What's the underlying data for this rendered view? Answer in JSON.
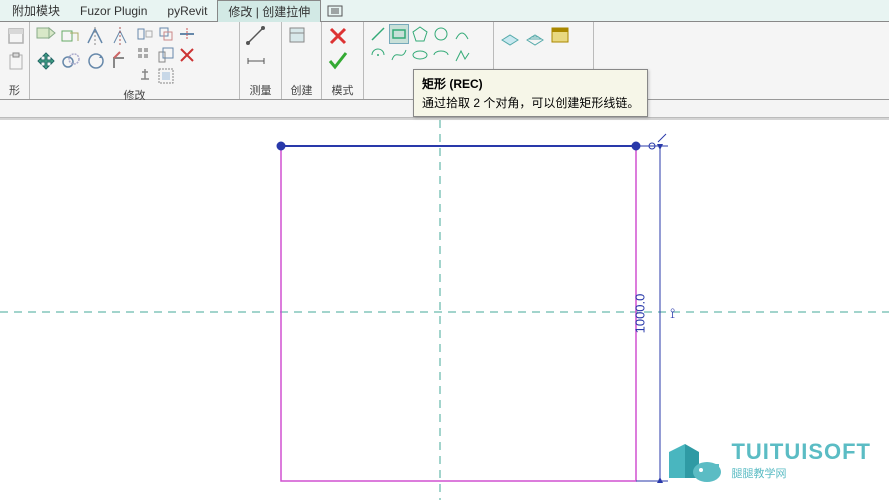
{
  "tabs": {
    "addin": "附加模块",
    "fuzor": "Fuzor Plugin",
    "pyrevit": "pyRevit",
    "active": "修改 | 创建拉伸"
  },
  "ribbon_groups": {
    "g0": "形",
    "g1": "修改",
    "g2": "测量",
    "g3": "创建",
    "g4": "模式"
  },
  "tooltip": {
    "title": "矩形 (REC)",
    "body": "通过拾取 2 个对角，可以创建矩形线链。"
  },
  "dimension": "1000.0",
  "watermark": {
    "brand": "TUITUISOFT",
    "sub": "腿腿教学网"
  }
}
